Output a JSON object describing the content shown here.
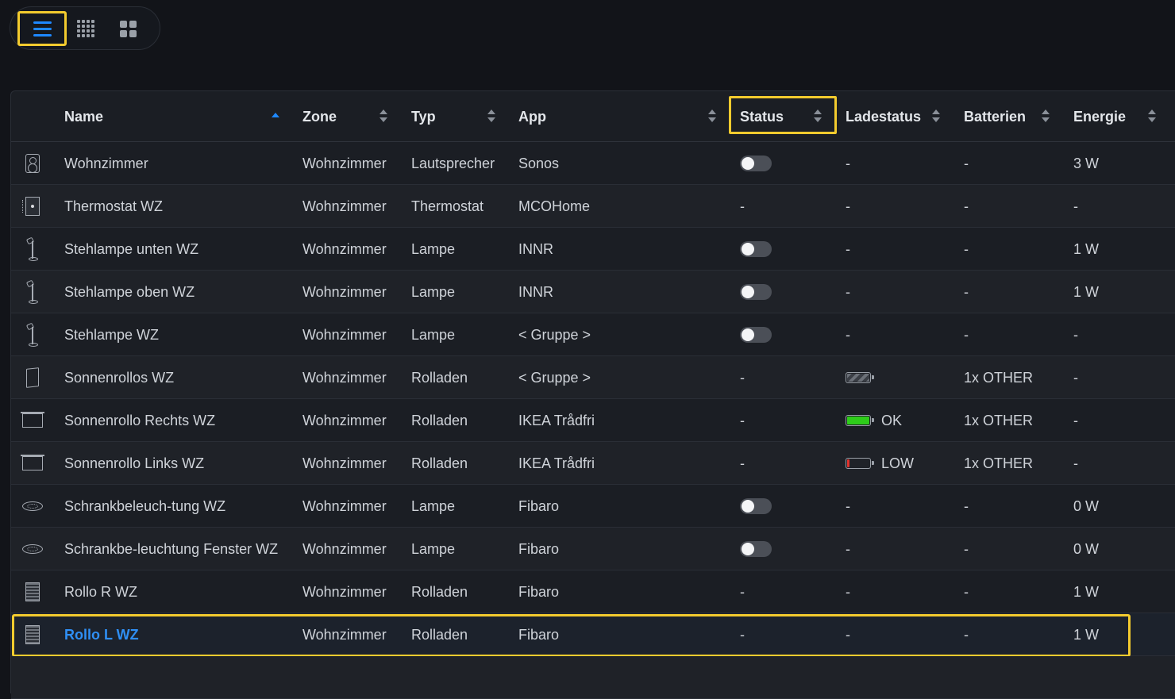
{
  "view_switch": {
    "list_icon": "list-view-icon",
    "grid_icon": "grid-view-icon",
    "tiles_icon": "tiles-view-icon",
    "active": "list"
  },
  "table": {
    "columns": [
      "Name",
      "Zone",
      "Typ",
      "App",
      "Status",
      "Ladestatus",
      "Batterien",
      "Energie"
    ],
    "sort_column": "Name",
    "sort_direction": "ascending",
    "rows": [
      {
        "icon": "speaker-icon",
        "name": "Wohnzimmer",
        "zone": "Wohnzimmer",
        "typ": "Lautsprecher",
        "app": "Sonos",
        "status": "toggle-off",
        "ladestatus": "-",
        "batterien": "-",
        "energie": "3 W"
      },
      {
        "icon": "thermostat-icon",
        "name": "Thermostat WZ",
        "zone": "Wohnzimmer",
        "typ": "Thermostat",
        "app": "MCOHome",
        "status": "-",
        "ladestatus": "-",
        "batterien": "-",
        "energie": "-"
      },
      {
        "icon": "floor-lamp-icon",
        "name": "Stehlampe unten WZ",
        "zone": "Wohnzimmer",
        "typ": "Lampe",
        "app": "INNR",
        "status": "toggle-off",
        "ladestatus": "-",
        "batterien": "-",
        "energie": "1 W"
      },
      {
        "icon": "floor-lamp-icon",
        "name": "Stehlampe oben WZ",
        "zone": "Wohnzimmer",
        "typ": "Lampe",
        "app": "INNR",
        "status": "toggle-off",
        "ladestatus": "-",
        "batterien": "-",
        "energie": "1 W"
      },
      {
        "icon": "floor-lamp-icon",
        "name": "Stehlampe WZ",
        "zone": "Wohnzimmer",
        "typ": "Lampe",
        "app": "< Gruppe >",
        "status": "toggle-off",
        "ladestatus": "-",
        "batterien": "-",
        "energie": "-"
      },
      {
        "icon": "blind-icon",
        "name": "Sonnenrollos WZ",
        "zone": "Wohnzimmer",
        "typ": "Rolladen",
        "app": "< Gruppe >",
        "status": "-",
        "ladestatus": "battery-unknown",
        "ladestatus_text": "",
        "batterien": "1x OTHER",
        "energie": "-"
      },
      {
        "icon": "window-blind-icon",
        "name": "Sonnenrollo Rechts WZ",
        "zone": "Wohnzimmer",
        "typ": "Rolladen",
        "app": "IKEA Trådfri",
        "status": "-",
        "ladestatus": "battery-full",
        "ladestatus_text": "OK",
        "batterien": "1x OTHER",
        "energie": "-"
      },
      {
        "icon": "window-blind-icon",
        "name": "Sonnenrollo Links WZ",
        "zone": "Wohnzimmer",
        "typ": "Rolladen",
        "app": "IKEA Trådfri",
        "status": "-",
        "ladestatus": "battery-low",
        "ladestatus_text": "LOW",
        "batterien": "1x OTHER",
        "energie": "-"
      },
      {
        "icon": "ceiling-light-icon",
        "name": "Schrankbeleuch-tung WZ",
        "zone": "Wohnzimmer",
        "typ": "Lampe",
        "app": "Fibaro",
        "status": "toggle-off",
        "ladestatus": "-",
        "batterien": "-",
        "energie": "0 W"
      },
      {
        "icon": "ceiling-light-icon",
        "name": "Schrankbe-leuchtung Fenster WZ",
        "zone": "Wohnzimmer",
        "typ": "Lampe",
        "app": "Fibaro",
        "status": "toggle-off",
        "ladestatus": "-",
        "batterien": "-",
        "energie": "0 W"
      },
      {
        "icon": "roller-shutter-icon",
        "name": "Rollo R WZ",
        "zone": "Wohnzimmer",
        "typ": "Rolladen",
        "app": "Fibaro",
        "status": "-",
        "ladestatus": "-",
        "batterien": "-",
        "energie": "1 W"
      },
      {
        "icon": "roller-shutter-icon",
        "name": "Rollo L WZ",
        "zone": "Wohnzimmer",
        "typ": "Rolladen",
        "app": "Fibaro",
        "status": "-",
        "ladestatus": "-",
        "batterien": "-",
        "energie": "1 W",
        "selected": true
      }
    ]
  },
  "colors": {
    "accent": "#1e88ff",
    "highlight": "#f3cb2e",
    "battery_ok": "#2ecc1a",
    "battery_low": "#e0322d"
  }
}
